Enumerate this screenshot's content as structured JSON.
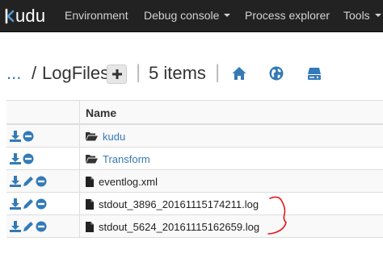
{
  "navbar": {
    "brand": "udu",
    "items": [
      "Environment",
      "Debug console",
      "Process explorer",
      "Tools"
    ]
  },
  "path": {
    "ellipsis": "...",
    "separator": "/",
    "folder": "LogFiles",
    "items_count": "5 items"
  },
  "table": {
    "header_name": "Name",
    "rows": [
      {
        "name": "kudu",
        "type": "folder",
        "editable": false
      },
      {
        "name": "Transform",
        "type": "folder",
        "editable": false
      },
      {
        "name": "eventlog.xml",
        "type": "file",
        "editable": true
      },
      {
        "name": "stdout_3896_20161115174211.log",
        "type": "file",
        "editable": true
      },
      {
        "name": "stdout_5624_20161115162659.log",
        "type": "file",
        "editable": true
      }
    ]
  },
  "colors": {
    "navbar_bg": "#222222",
    "link": "#337ab7",
    "annotation": "#e8141c"
  },
  "icons": {
    "home": "home-icon",
    "globe": "globe-icon",
    "drive": "hdd-icon",
    "download": "download-icon",
    "edit": "pencil-icon",
    "delete": "minus-circle-icon",
    "folder": "folder-open-icon",
    "file": "file-icon",
    "plus": "plus-icon"
  }
}
